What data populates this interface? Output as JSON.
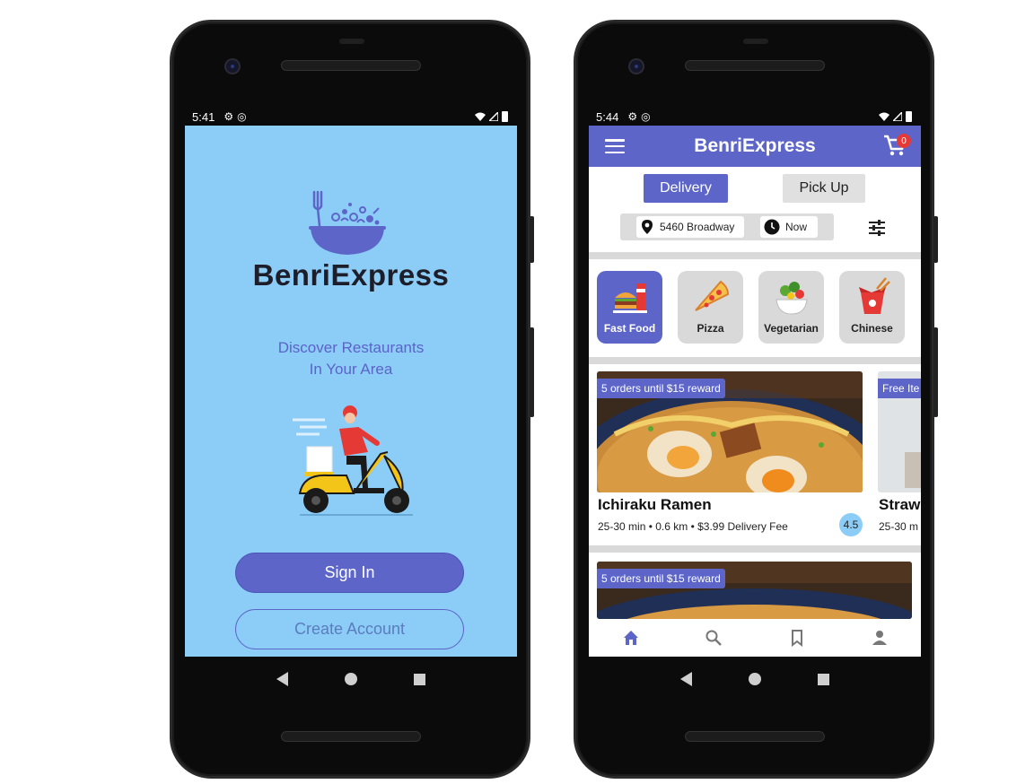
{
  "left_phone": {
    "status": {
      "time": "5:41",
      "icons": [
        "settings-icon",
        "sync-icon"
      ],
      "right_icons": [
        "wifi-icon",
        "signal-icon",
        "battery-icon"
      ]
    },
    "brand": "BenriExpress",
    "tagline_line1": "Discover Restaurants",
    "tagline_line2": "In Your Area",
    "signin_label": "Sign In",
    "create_label": "Create Account",
    "colors": {
      "background": "#8ccdf8",
      "accent": "#5d66c8"
    }
  },
  "right_phone": {
    "status": {
      "time": "5:44"
    },
    "brand": "BenriExpress",
    "cart_count": "0",
    "tabs": {
      "delivery": "Delivery",
      "pickup": "Pick Up"
    },
    "location": {
      "address": "5460 Broadway",
      "time": "Now"
    },
    "categories": [
      {
        "label": "Fast Food",
        "icon": "fast-food-icon",
        "active": true
      },
      {
        "label": "Pizza",
        "icon": "pizza-icon",
        "active": false
      },
      {
        "label": "Vegetarian",
        "icon": "salad-icon",
        "active": false
      },
      {
        "label": "Chinese",
        "icon": "takeout-box-icon",
        "active": false
      }
    ],
    "restaurants": [
      {
        "badge": "5 orders until $15 reward",
        "name": "Ichiraku Ramen",
        "meta": "25-30 min  •  0.6 km  •  $3.99 Delivery Fee",
        "rating": "4.5"
      },
      {
        "badge": "Free Ite",
        "name": "Straw",
        "meta": "25-30 m"
      }
    ],
    "second_row_badge": "5 orders until $15 reward",
    "bottom_nav": [
      "home-icon",
      "search-icon",
      "bookmark-icon",
      "profile-icon"
    ],
    "colors": {
      "accent": "#5d66c8",
      "rating": "#8ccdf8"
    }
  }
}
